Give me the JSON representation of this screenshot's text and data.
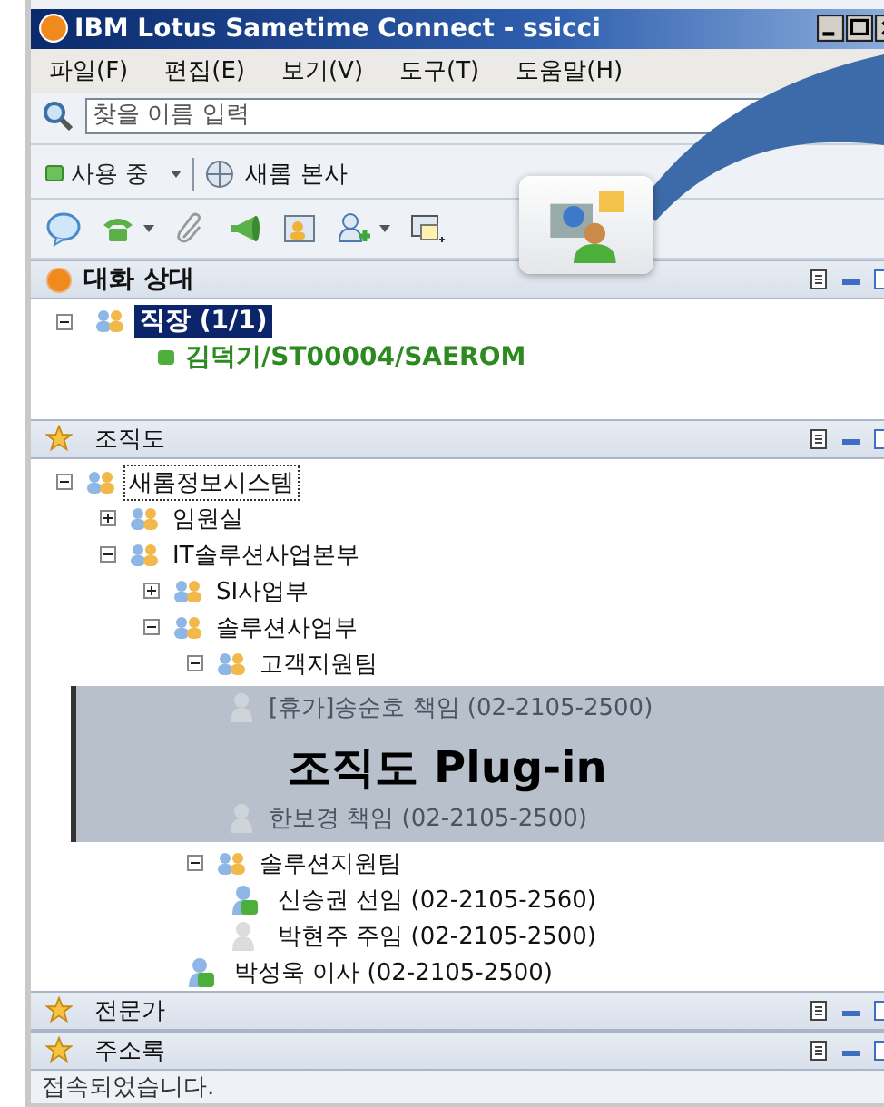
{
  "window": {
    "title": "IBM Lotus Sametime Connect - ssicci"
  },
  "menu": [
    "파일(F)",
    "편집(E)",
    "보기(V)",
    "도구(T)",
    "도움말(H)"
  ],
  "search": {
    "placeholder": "찾을 이름 입력"
  },
  "status": {
    "label": "사용 중",
    "location": "새롬 본사"
  },
  "contacts": {
    "title": "대화 상대",
    "groups": [
      {
        "label": "직장 (1/1)",
        "selected": true,
        "expanded": true,
        "members": [
          {
            "label": "김덕기/ST00004/SAEROM",
            "online": true
          }
        ]
      }
    ]
  },
  "org_chart": {
    "title": "조직도",
    "tree": [
      {
        "kind": "group",
        "label": "새롬정보시스템",
        "expanded": true,
        "children": [
          {
            "kind": "group",
            "label": "임원실",
            "expanded": false
          },
          {
            "kind": "group",
            "label": "IT솔루션사업본부",
            "expanded": true,
            "children": [
              {
                "kind": "group",
                "label": "SI사업부",
                "expanded": false
              },
              {
                "kind": "group",
                "label": "솔루션사업부",
                "expanded": true,
                "children": [
                  {
                    "kind": "group",
                    "label": "고객지원팀",
                    "expanded": true,
                    "overlay": "조직도 Plug-in",
                    "children": [
                      {
                        "kind": "person",
                        "label": "[휴가]송순호 책임 (02-2105-2500)"
                      },
                      {
                        "kind": "person",
                        "label": "한보경 책임 (02-2105-2500)"
                      }
                    ]
                  },
                  {
                    "kind": "group",
                    "label": "솔루션지원팀",
                    "expanded": true,
                    "children": [
                      {
                        "kind": "person",
                        "label": "신승권 선임 (02-2105-2560)",
                        "online": true
                      },
                      {
                        "kind": "person",
                        "label": "박현주 주임 (02-2105-2500)",
                        "online": false
                      }
                    ]
                  },
                  {
                    "kind": "person",
                    "label": "박성욱 이사 (02-2105-2500)",
                    "online": true
                  }
                ]
              }
            ]
          }
        ]
      }
    ]
  },
  "sections": [
    "전문가",
    "주소록"
  ],
  "status_bar": "접속되었습니다."
}
